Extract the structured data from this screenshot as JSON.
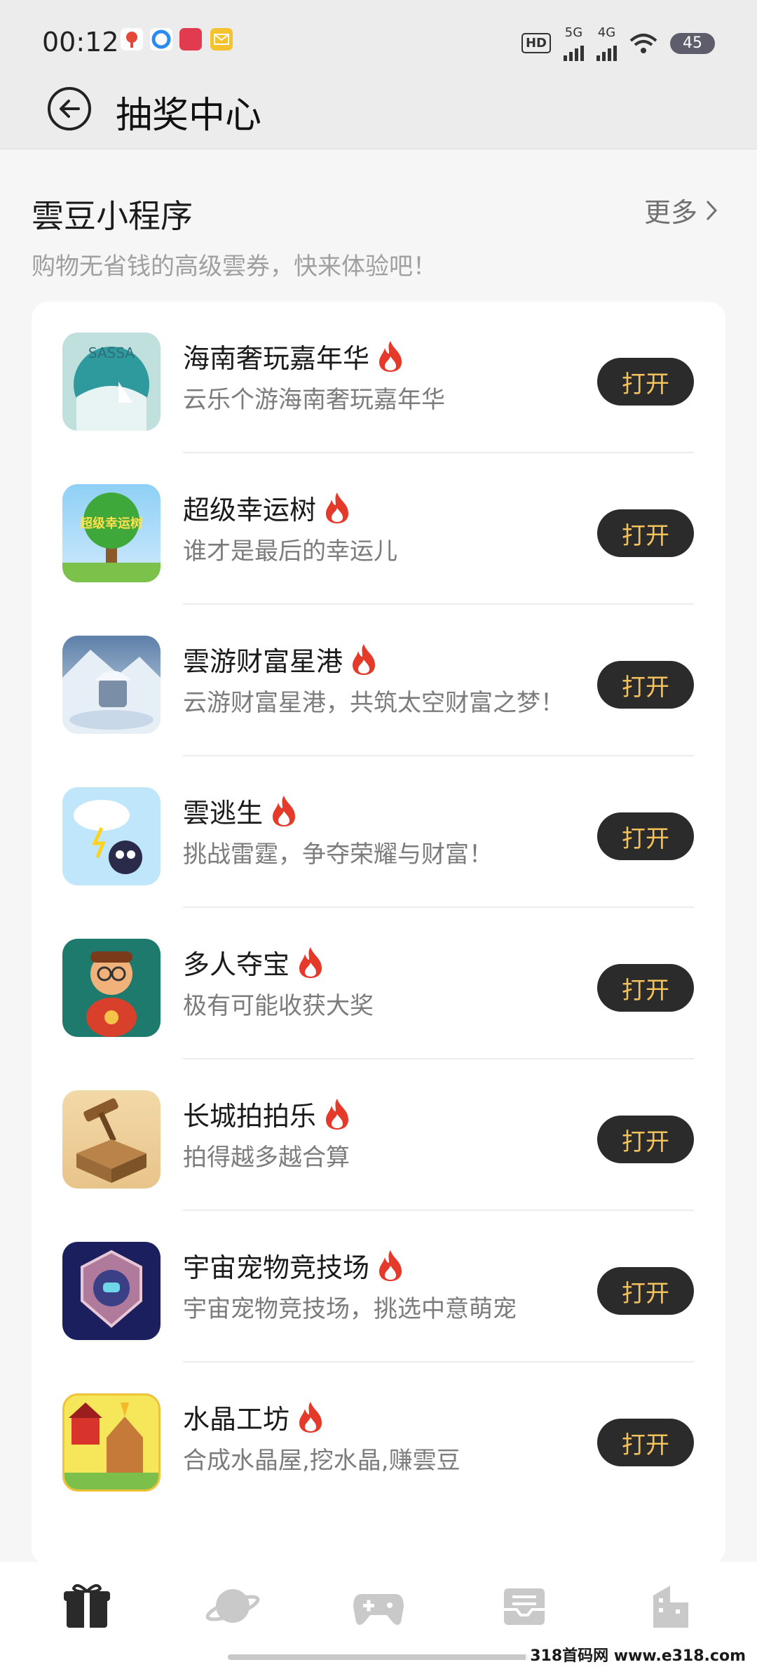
{
  "status_bar": {
    "time": "00:12",
    "hd_label": "HD",
    "net1": "5G",
    "net2": "4G",
    "battery": "45"
  },
  "header": {
    "title": "抽奖中心"
  },
  "section": {
    "title": "雲豆小程序",
    "subtitle": "购物无省钱的高级雲券，快来体验吧！",
    "more_label": "更多"
  },
  "apps": [
    {
      "name": "海南奢玩嘉年华",
      "desc": "云乐个游海南奢玩嘉年华",
      "button": "打开",
      "icon": "sassa-icon",
      "icon_text": "SASSA"
    },
    {
      "name": "超级幸运树",
      "desc": "谁才是最后的幸运儿",
      "button": "打开",
      "icon": "lucky-tree-icon",
      "icon_text": "超级幸运树"
    },
    {
      "name": "雲游财富星港",
      "desc": "云游财富星港，共筑太空财富之梦！",
      "button": "打开",
      "icon": "snow-house-icon"
    },
    {
      "name": "雲逃生",
      "desc": "挑战雷霆，争夺荣耀与财富！",
      "button": "打开",
      "icon": "storm-cloud-icon"
    },
    {
      "name": "多人夺宝",
      "desc": "极有可能收获大奖",
      "button": "打开",
      "icon": "treasure-man-icon"
    },
    {
      "name": "长城拍拍乐",
      "desc": "拍得越多越合算",
      "button": "打开",
      "icon": "auction-hammer-icon"
    },
    {
      "name": "宇宙宠物竞技场",
      "desc": "宇宙宠物竞技场，挑选中意萌宠",
      "button": "打开",
      "icon": "pet-arena-badge-icon"
    },
    {
      "name": "水晶工坊",
      "desc": "合成水晶屋,挖水晶,赚雲豆",
      "button": "打开",
      "icon": "crystal-workshop-icon"
    }
  ],
  "bottom_nav": [
    {
      "icon": "gift-icon",
      "active": true
    },
    {
      "icon": "planet-icon",
      "active": false
    },
    {
      "icon": "gamepad-icon",
      "active": false
    },
    {
      "icon": "inbox-icon",
      "active": false
    },
    {
      "icon": "building-icon",
      "active": false
    }
  ],
  "watermark": "318首码网 www.e318.com",
  "colors": {
    "button_bg": "#2b2b2b",
    "button_text": "#f2c15a",
    "fire": "#e53a2a"
  }
}
